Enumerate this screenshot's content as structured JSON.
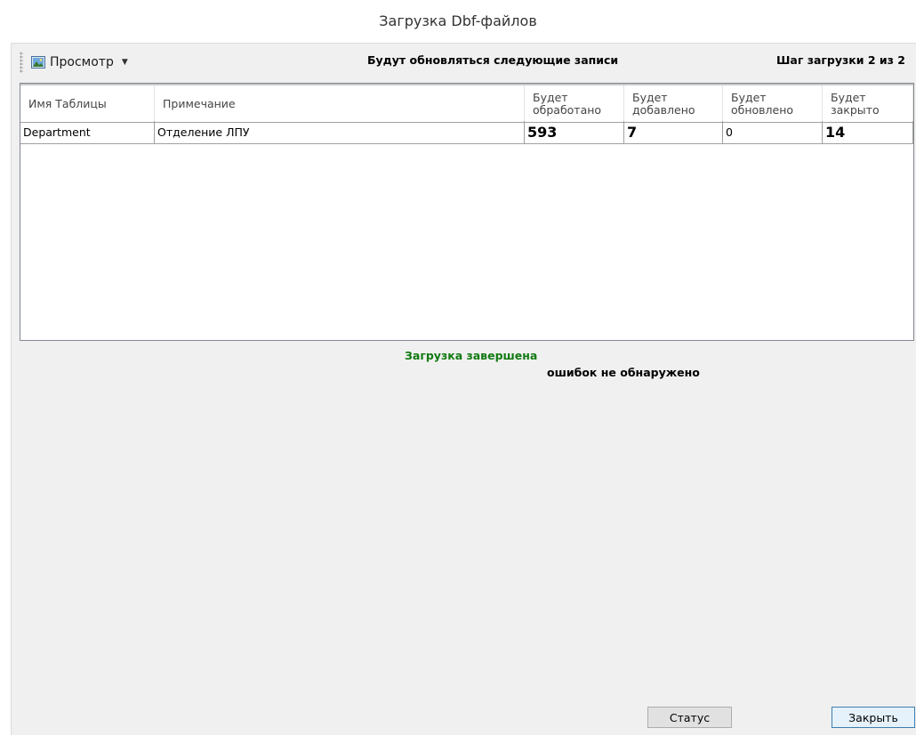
{
  "window": {
    "title": "Загрузка Dbf-файлов"
  },
  "toolbar": {
    "view_label": "Просмотр",
    "header_caption": "Будут обновляться следующие записи",
    "step_caption": "Шаг загрузки 2 из 2"
  },
  "grid": {
    "columns": [
      "Имя Таблицы",
      "Примечание",
      "Будет\nобработано",
      "Будет\nдобавлено",
      "Будет\nобновлено",
      "Будет\nзакрыто"
    ],
    "rows": [
      {
        "table_name": "Department",
        "note": "Отделение ЛПУ",
        "processed": "593",
        "added": "7",
        "updated": "0",
        "closed": "14"
      }
    ]
  },
  "status": {
    "done_text": "Загрузка завершена",
    "errors_text": "ошибок не обнаружено"
  },
  "buttons": {
    "status_label": "Статус",
    "close_label": "Закрыть"
  },
  "colors": {
    "success": "#127a12",
    "panel_bg": "#f0f0f0"
  }
}
